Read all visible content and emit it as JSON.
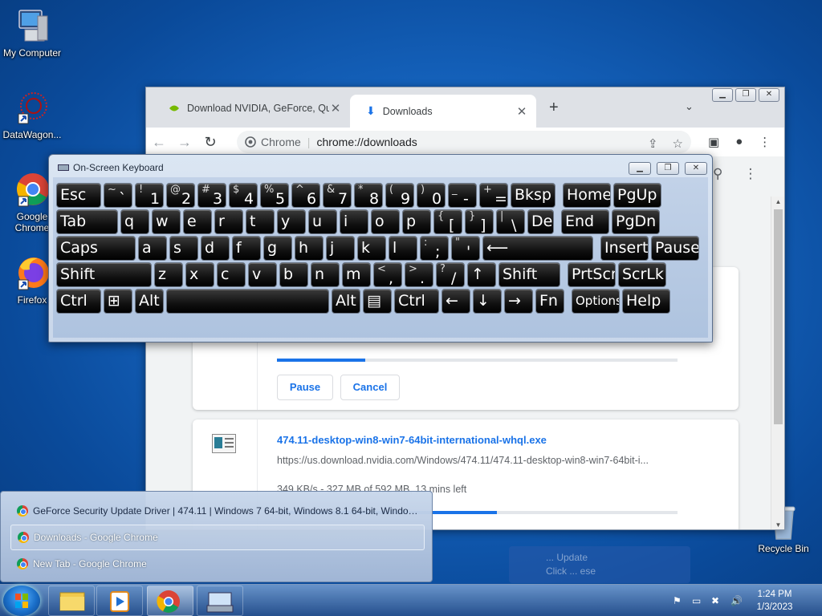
{
  "desktop": {
    "icons": [
      {
        "label": "My Computer"
      },
      {
        "label": "DataWagon..."
      },
      {
        "label": "Google Chrome"
      },
      {
        "label": "Firefox"
      },
      {
        "label": "Recycle Bin"
      }
    ]
  },
  "chrome": {
    "tabs": [
      {
        "title": "Download NVIDIA, GeForce, Qua",
        "active": false
      },
      {
        "title": "Downloads",
        "active": true
      }
    ],
    "new_tab": "+",
    "close_glyph": "✕",
    "omnibox": {
      "scheme_label": "Chrome",
      "url": "chrome://downloads"
    },
    "downloads": [
      {
        "progress": 0.22,
        "pause_label": "Pause",
        "cancel_label": "Cancel"
      },
      {
        "filename": "474.11-desktop-win8-win7-64bit-international-whql.exe",
        "url": "https://us.download.nvidia.com/Windows/474.11/474.11-desktop-win8-win7-64bit-i...",
        "status": "349 KB/s - 327 MB of 592 MB, 13 mins left",
        "progress": 0.55
      }
    ]
  },
  "osk": {
    "title": "On-Screen Keyboard",
    "rows": [
      [
        {
          "k": "Esc"
        },
        {
          "s": "~",
          "m": "`"
        },
        {
          "s": "!",
          "m": "1"
        },
        {
          "s": "@",
          "m": "2"
        },
        {
          "s": "#",
          "m": "3"
        },
        {
          "s": "$",
          "m": "4"
        },
        {
          "s": "%",
          "m": "5"
        },
        {
          "s": "^",
          "m": "6"
        },
        {
          "s": "&",
          "m": "7"
        },
        {
          "s": "*",
          "m": "8"
        },
        {
          "s": "(",
          "m": "9"
        },
        {
          "s": ")",
          "m": "0"
        },
        {
          "s": "_",
          "m": "-"
        },
        {
          "s": "+",
          "m": "="
        },
        {
          "k": "Bksp"
        },
        {
          "k": "Home"
        },
        {
          "k": "PgUp"
        }
      ],
      [
        {
          "k": "Tab"
        },
        {
          "k": "q"
        },
        {
          "k": "w"
        },
        {
          "k": "e"
        },
        {
          "k": "r"
        },
        {
          "k": "t"
        },
        {
          "k": "y"
        },
        {
          "k": "u"
        },
        {
          "k": "i"
        },
        {
          "k": "o"
        },
        {
          "k": "p"
        },
        {
          "s": "{",
          "m": "["
        },
        {
          "s": "}",
          "m": "]"
        },
        {
          "s": "|",
          "m": "\\"
        },
        {
          "k": "Del"
        },
        {
          "k": "End"
        },
        {
          "k": "PgDn"
        }
      ],
      [
        {
          "k": "Caps"
        },
        {
          "k": "a"
        },
        {
          "k": "s"
        },
        {
          "k": "d"
        },
        {
          "k": "f"
        },
        {
          "k": "g"
        },
        {
          "k": "h"
        },
        {
          "k": "j"
        },
        {
          "k": "k"
        },
        {
          "k": "l"
        },
        {
          "s": ":",
          "m": ";"
        },
        {
          "s": "\"",
          "m": "'"
        },
        {
          "k": "⟵"
        },
        {
          "k": "Insert"
        },
        {
          "k": "Pause"
        }
      ],
      [
        {
          "k": "Shift"
        },
        {
          "k": "z"
        },
        {
          "k": "x"
        },
        {
          "k": "c"
        },
        {
          "k": "v"
        },
        {
          "k": "b"
        },
        {
          "k": "n"
        },
        {
          "k": "m"
        },
        {
          "s": "<",
          "m": ","
        },
        {
          "s": ">",
          "m": "."
        },
        {
          "s": "?",
          "m": "/"
        },
        {
          "k": "↑"
        },
        {
          "k": "Shift"
        },
        {
          "k": "PrtScn"
        },
        {
          "k": "ScrLk"
        }
      ],
      [
        {
          "k": "Ctrl"
        },
        {
          "k": "⊞"
        },
        {
          "k": "Alt"
        },
        {
          "k": ""
        },
        {
          "k": "Alt"
        },
        {
          "k": "▤"
        },
        {
          "k": "Ctrl"
        },
        {
          "k": "←"
        },
        {
          "k": "↓"
        },
        {
          "k": "→"
        },
        {
          "k": "Fn"
        },
        {
          "k": "Options"
        },
        {
          "k": "Help"
        }
      ]
    ]
  },
  "jumplist": {
    "items": [
      {
        "label": "GeForce Security Update Driver | 474.11 | Windows 7 64-bit, Windows 8.1 64-bit, Windows 8..."
      },
      {
        "label": "Downloads - Google Chrome",
        "selected": true
      },
      {
        "label": "New Tab - Google Chrome"
      }
    ]
  },
  "taskbar": {
    "clock_time": "1:24 PM",
    "clock_date": "1/3/2023"
  },
  "toast": {
    "line1": "... Update",
    "line2": "Click ... ese"
  }
}
